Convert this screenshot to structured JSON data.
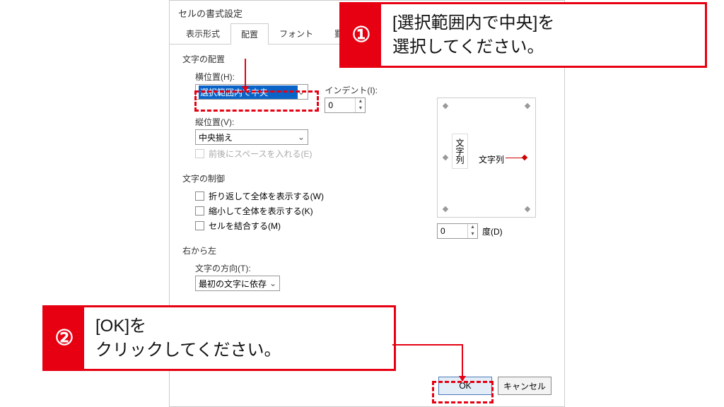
{
  "dialog": {
    "title": "セルの書式設定",
    "tabs": [
      "表示形式",
      "配置",
      "フォント",
      "罫線"
    ],
    "active_tab": 1
  },
  "alignment": {
    "group": "文字の配置",
    "h_label": "横位置(H):",
    "h_value": "選択範囲内で中央",
    "indent_label": "インデント(I):",
    "indent_value": "0",
    "v_label": "縦位置(V):",
    "v_value": "中央揃え",
    "distribute_label": "前後にスペースを入れる(E)"
  },
  "control": {
    "group": "文字の制御",
    "wrap": "折り返して全体を表示する(W)",
    "shrink": "縮小して全体を表示する(K)",
    "merge": "セルを結合する(M)"
  },
  "rtl": {
    "group": "右から左",
    "dir_label": "文字の方向(T):",
    "dir_value": "最初の文字に依存"
  },
  "orientation": {
    "vtext": "文字列",
    "htext": "文字列",
    "degree_value": "0",
    "degree_label": "度(D)"
  },
  "buttons": {
    "ok": "OK",
    "cancel": "キャンセル"
  },
  "callouts": {
    "one_num": "①",
    "one_text": "[選択範囲内で中央]を\n選択してください。",
    "two_num": "②",
    "two_text": "[OK]を\nクリックしてください。"
  }
}
